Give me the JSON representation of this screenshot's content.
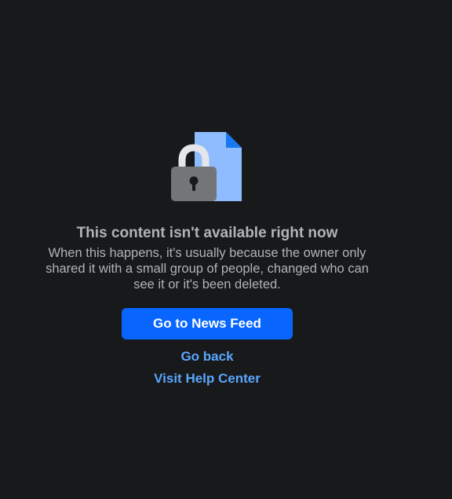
{
  "colors": {
    "background": "#18191a",
    "text_secondary": "#b0b3b8",
    "primary_button": "#0866ff",
    "link": "#5aa7ff",
    "document_fill": "#8ebcff",
    "document_fold": "#1877f2",
    "lock_body": "#747578",
    "lock_shackle": "#e4e6eb"
  },
  "illustration": {
    "document_icon": "document-icon",
    "lock_icon": "padlock-icon"
  },
  "message": {
    "title": "This content isn't available right now",
    "description": "When this happens, it's usually because the owner only shared it with a small group of people, changed who can see it or it's been deleted."
  },
  "actions": {
    "primary_label": "Go to News Feed",
    "back_label": "Go back",
    "help_label": "Visit Help Center"
  }
}
